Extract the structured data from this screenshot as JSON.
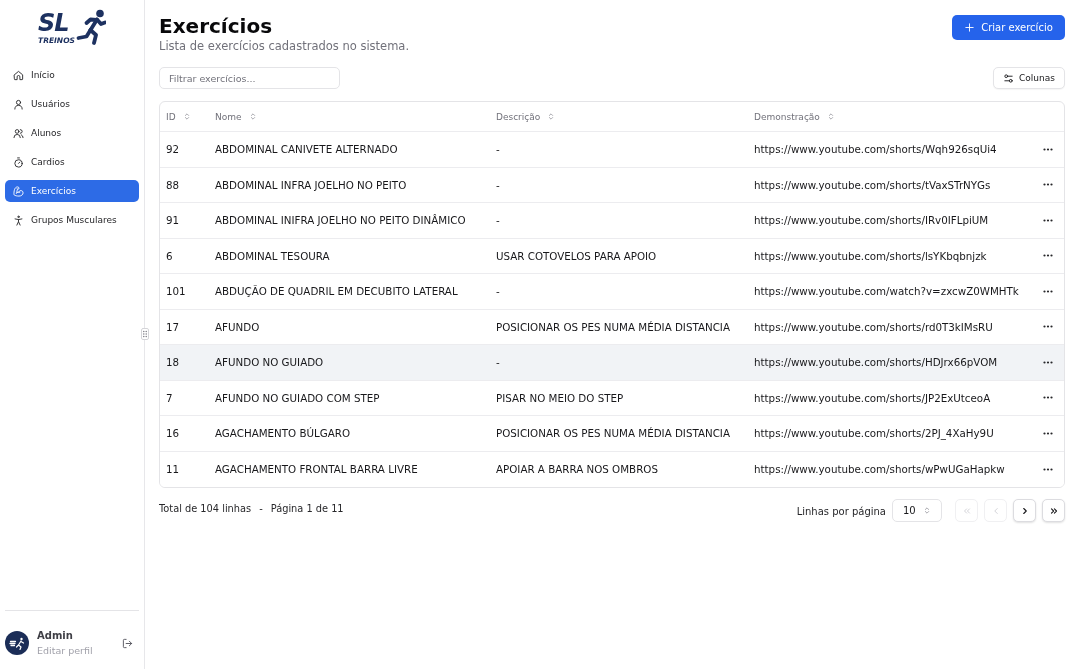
{
  "sidebar": {
    "logo": {
      "mark": "SL",
      "tagline": "TREINOS"
    },
    "nav": [
      {
        "label": "Início",
        "selected": false
      },
      {
        "label": "Usuários",
        "selected": false
      },
      {
        "label": "Alunos",
        "selected": false
      },
      {
        "label": "Cardios",
        "selected": false
      },
      {
        "label": "Exercícios",
        "selected": true
      },
      {
        "label": "Grupos Musculares",
        "selected": false
      }
    ],
    "user": {
      "name": "Admin",
      "link": "Editar perfil"
    }
  },
  "header": {
    "title": "Exercícios",
    "subtitle": "Lista de exercícios cadastrados no sistema.",
    "create_button": "Criar exercício"
  },
  "toolbar": {
    "filter": {
      "placeholder": "Filtrar exercícios..."
    },
    "columns_button": "Colunas"
  },
  "table": {
    "columns": [
      {
        "label": "ID",
        "sortable": true
      },
      {
        "label": "Nome",
        "sortable": true
      },
      {
        "label": "Descrição",
        "sortable": true
      },
      {
        "label": "Demonstração",
        "sortable": true
      }
    ],
    "rows": [
      {
        "cells": [
          "92",
          "ABDOMINAL CANIVETE ALTERNADO",
          "-",
          "https://www.youtube.com/shorts/Wqh926sqUi4"
        ],
        "hovered": false
      },
      {
        "cells": [
          "88",
          "ABDOMINAL INFRA JOELHO NO PEITO",
          "-",
          "https://www.youtube.com/shorts/tVaxSTrNYGs"
        ],
        "hovered": false
      },
      {
        "cells": [
          "91",
          "ABDOMINAL INIFRA JOELHO NO PEITO DINÂMICO",
          "-",
          "https://www.youtube.com/shorts/IRv0IFLpiUM"
        ],
        "hovered": false
      },
      {
        "cells": [
          "6",
          "ABDOMINAL TESOURA",
          "USAR COTOVELOS PARA APOIO",
          "https://www.youtube.com/shorts/lsYKbqbnjzk"
        ],
        "hovered": false
      },
      {
        "cells": [
          "101",
          "ABDUÇÃO DE QUADRIL EM DECUBITO LATERAL",
          "-",
          "https://www.youtube.com/watch?v=zxcwZ0WMHTk"
        ],
        "hovered": false
      },
      {
        "cells": [
          "17",
          "AFUNDO",
          "POSICIONAR OS PES NUMA MÉDIA DISTANCIA",
          "https://www.youtube.com/shorts/rd0T3kIMsRU"
        ],
        "hovered": false
      },
      {
        "cells": [
          "18",
          "AFUNDO NO GUIADO",
          "-",
          "https://www.youtube.com/shorts/HDJrx66pVOM"
        ],
        "hovered": true
      },
      {
        "cells": [
          "7",
          "AFUNDO NO GUIADO COM STEP",
          "PISAR NO MEIO DO STEP",
          "https://www.youtube.com/shorts/JP2ExUtceoA"
        ],
        "hovered": false
      },
      {
        "cells": [
          "16",
          "AGACHAMENTO BÚLGARO",
          "POSICIONAR OS PES NUMA MÉDIA DISTANCIA",
          "https://www.youtube.com/shorts/2PJ_4XaHy9U"
        ],
        "hovered": false
      },
      {
        "cells": [
          "11",
          "AGACHAMENTO FRONTAL BARRA LIVRE",
          "APOIAR A BARRA NOS OMBROS",
          "https://www.youtube.com/shorts/wPwUGaHapkw"
        ],
        "hovered": false
      }
    ]
  },
  "footer": {
    "total": "Total de 104 linhas",
    "separator": "-",
    "page": "Página 1 de 11",
    "rows_per_page_label": "Linhas por página",
    "rows_per_page": "10",
    "pager": [
      {
        "kind": "first",
        "disabled": true
      },
      {
        "kind": "previous",
        "disabled": true
      },
      {
        "kind": "next",
        "disabled": false
      },
      {
        "kind": "last",
        "disabled": false
      }
    ]
  }
}
